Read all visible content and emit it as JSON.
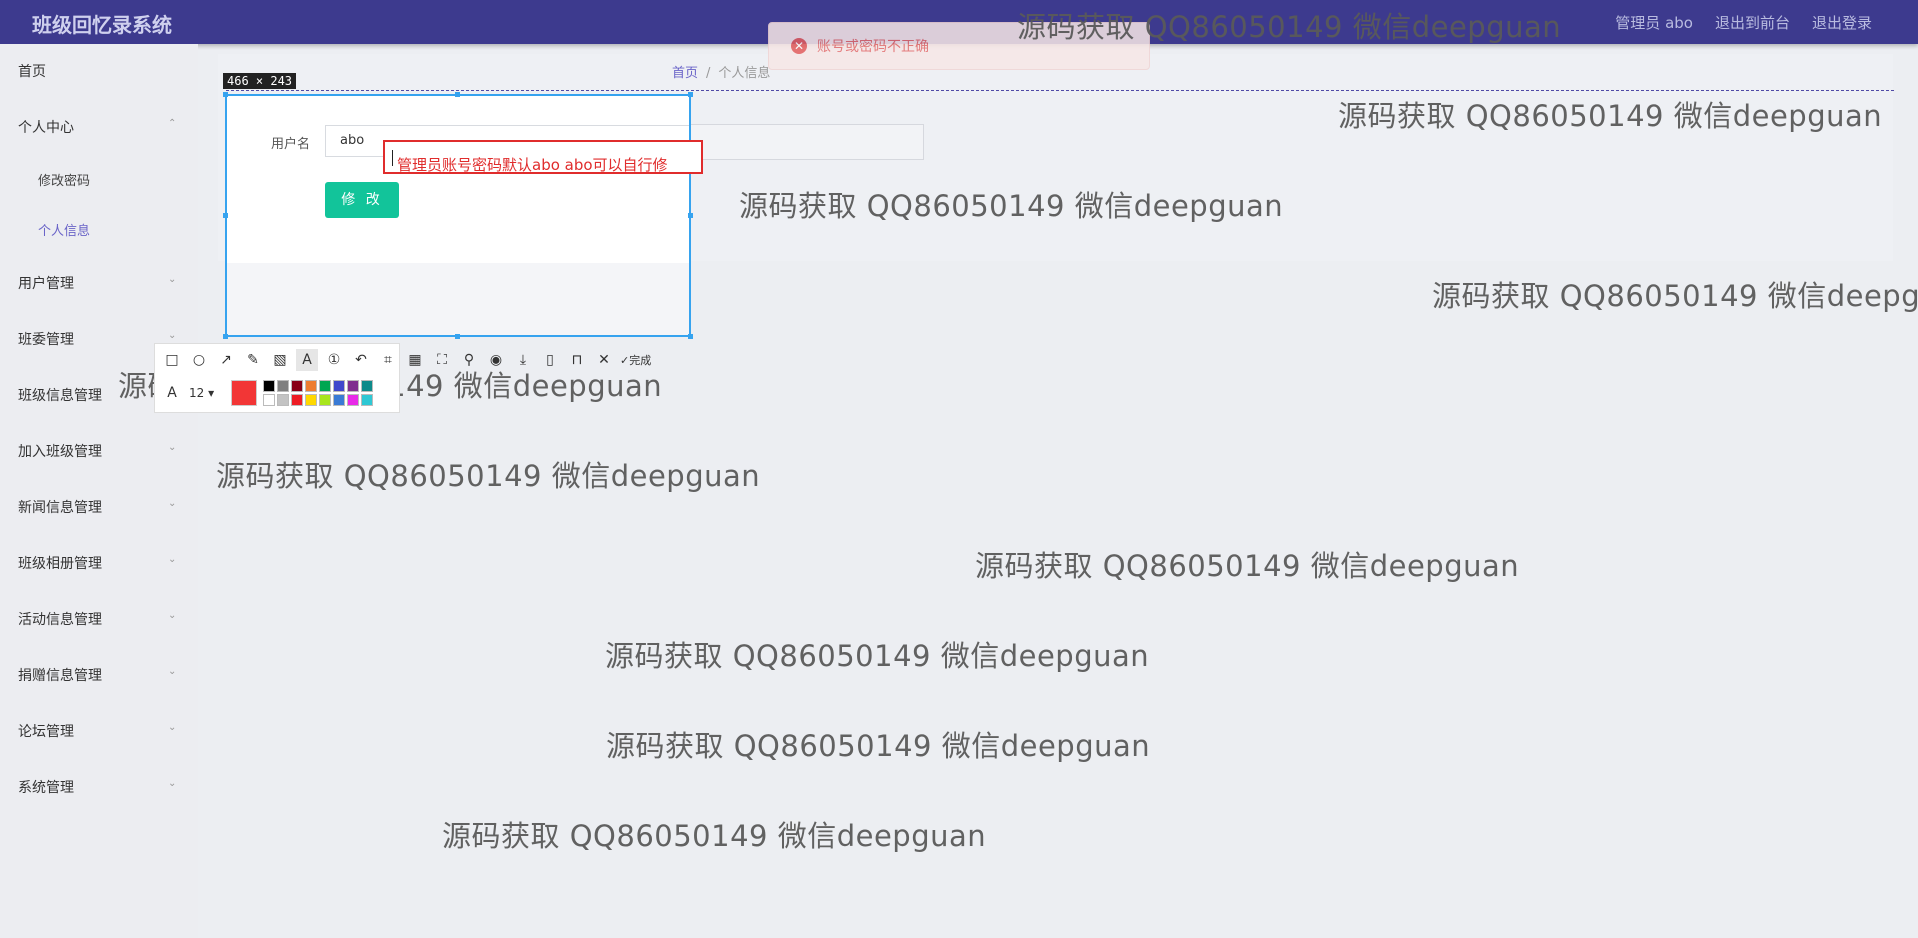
{
  "app": {
    "title": "班级回忆录系统"
  },
  "header": {
    "admin": "管理员 abo",
    "to_front": "退出到前台",
    "logout": "退出登录"
  },
  "toast": {
    "message": "账号或密码不正确"
  },
  "breadcrumb": {
    "home": "首页",
    "current": "个人信息"
  },
  "sidebar": {
    "items": [
      {
        "label": "首页"
      },
      {
        "label": "个人中心"
      },
      {
        "label": "用户管理"
      },
      {
        "label": "班委管理"
      },
      {
        "label": "班级信息管理"
      },
      {
        "label": "加入班级管理"
      },
      {
        "label": "新闻信息管理"
      },
      {
        "label": "班级相册管理"
      },
      {
        "label": "活动信息管理"
      },
      {
        "label": "捐赠信息管理"
      },
      {
        "label": "论坛管理"
      },
      {
        "label": "系统管理"
      }
    ],
    "subitems": [
      {
        "label": "修改密码"
      },
      {
        "label": "个人信息"
      }
    ]
  },
  "form": {
    "username_label": "用户名",
    "username_value": "abo",
    "save_label": "修 改"
  },
  "capture": {
    "size_label": "466 × 243",
    "annotation_text": "管理员账号密码默认abo abo可以自行修",
    "font_size": "12",
    "done_label": "完成",
    "current_color": "#f23636",
    "palette": [
      "#000000",
      "#7f7f7f",
      "#880015",
      "#ed7d31",
      "#00a651",
      "#3f48cc",
      "#7f2f8f",
      "#0e8a8a",
      "#ffffff",
      "#c3c3c3",
      "#ed1c24",
      "#ffd800",
      "#a8e61d",
      "#3a7bd5",
      "#e829e8",
      "#2ec8d4"
    ]
  },
  "watermark": {
    "text": "源码获取 QQ86050149 微信deepguan"
  }
}
